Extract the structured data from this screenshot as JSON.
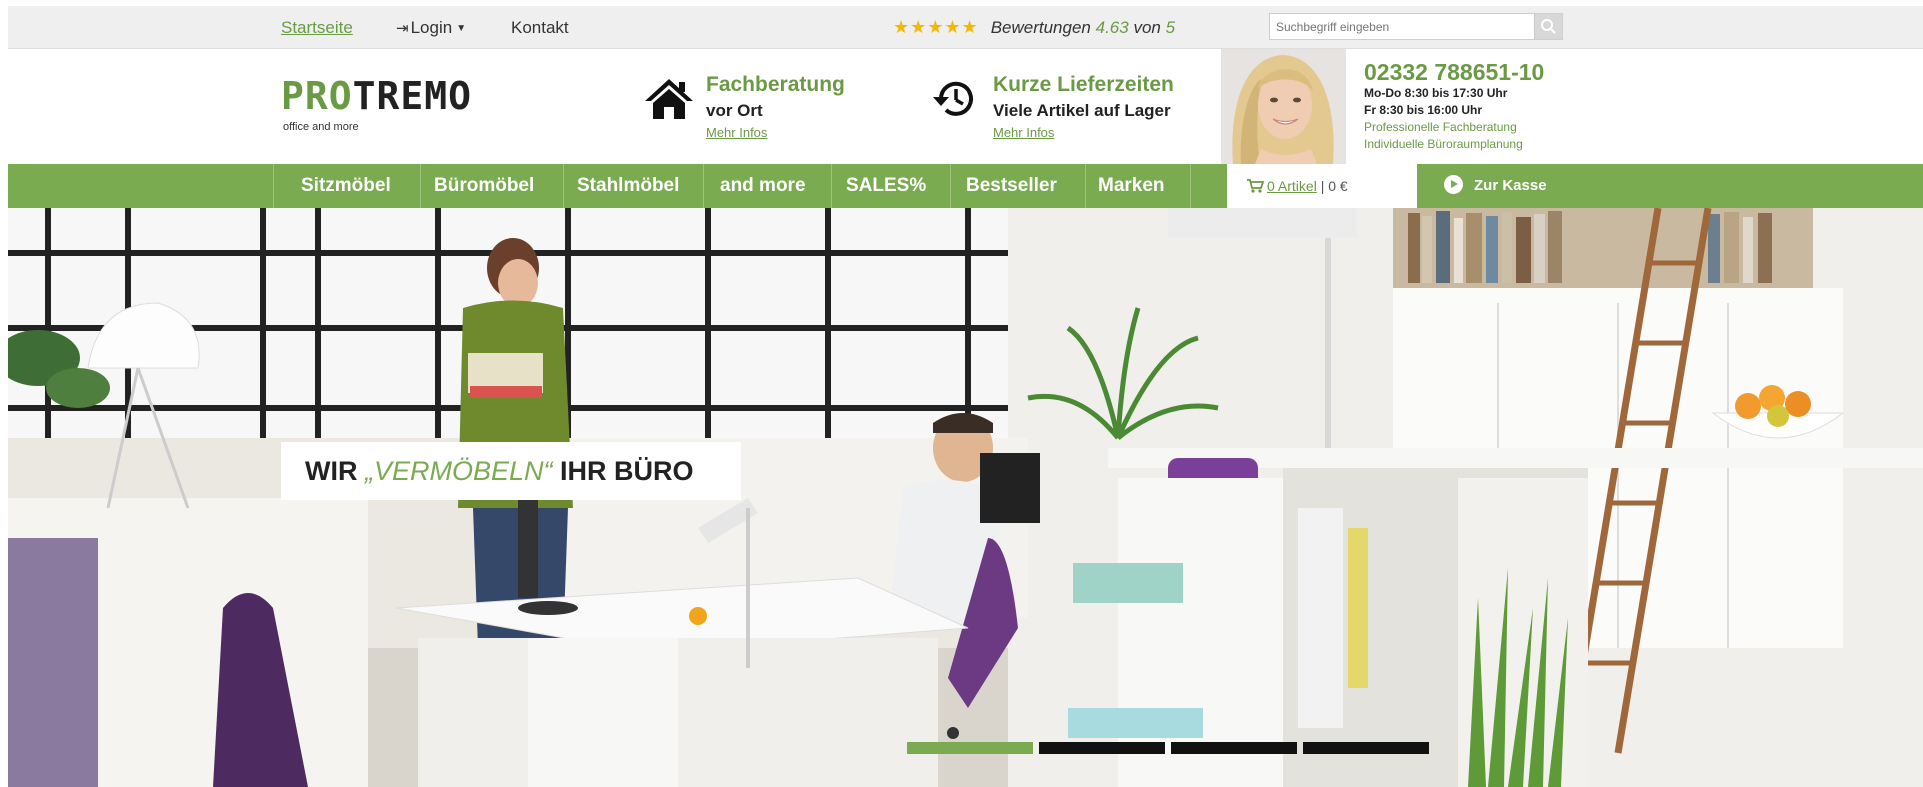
{
  "topbar": {
    "home_label": "Startseite",
    "login_label": "Login",
    "contact_label": "Kontakt",
    "rating": {
      "stars": "★★★★★",
      "prefix": "Bewertungen",
      "score": "4.63",
      "of": "von",
      "max": "5",
      "stars_value": 4.63
    },
    "search": {
      "placeholder": "Suchbegriff eingeben",
      "button_icon": "search-icon"
    }
  },
  "header": {
    "logo": {
      "accent": "PRO",
      "rest": "TREMO",
      "tagline": "office and more"
    },
    "features": [
      {
        "icon": "home-icon",
        "title": "Fachberatung",
        "subtitle": "vor Ort",
        "more": "Mehr Infos"
      },
      {
        "icon": "history-clock-icon",
        "title": "Kurze Lieferzeiten",
        "subtitle": "Viele Artikel auf Lager",
        "more": "Mehr Infos"
      }
    ],
    "contact": {
      "phone": "02332 788651-10",
      "hours_1": "Mo-Do 8:30 bis 17:30 Uhr",
      "hours_2": "Fr 8:30 bis 16:00 Uhr",
      "service_1": "Professionelle Fachberatung",
      "service_2": "Individuelle Büroraumplanung"
    }
  },
  "nav": {
    "items": [
      "Sitzmöbel",
      "Büromöbel",
      "Stahlmöbel",
      "and more",
      "SALES%",
      "Bestseller",
      "Marken"
    ],
    "cart": {
      "count_label": "0 Artikel",
      "separator": "|",
      "total": "0 €"
    },
    "checkout_label": "Zur Kasse"
  },
  "hero": {
    "caption_before": "WIR ",
    "caption_accent": "„VERMÖBELN“",
    "caption_after": " IHR BÜRO",
    "slides_total": 4,
    "active_slide": 1
  },
  "colors": {
    "brand_green": "#7aab51",
    "link_green": "#6b9a45",
    "star_gold": "#f5b800"
  }
}
